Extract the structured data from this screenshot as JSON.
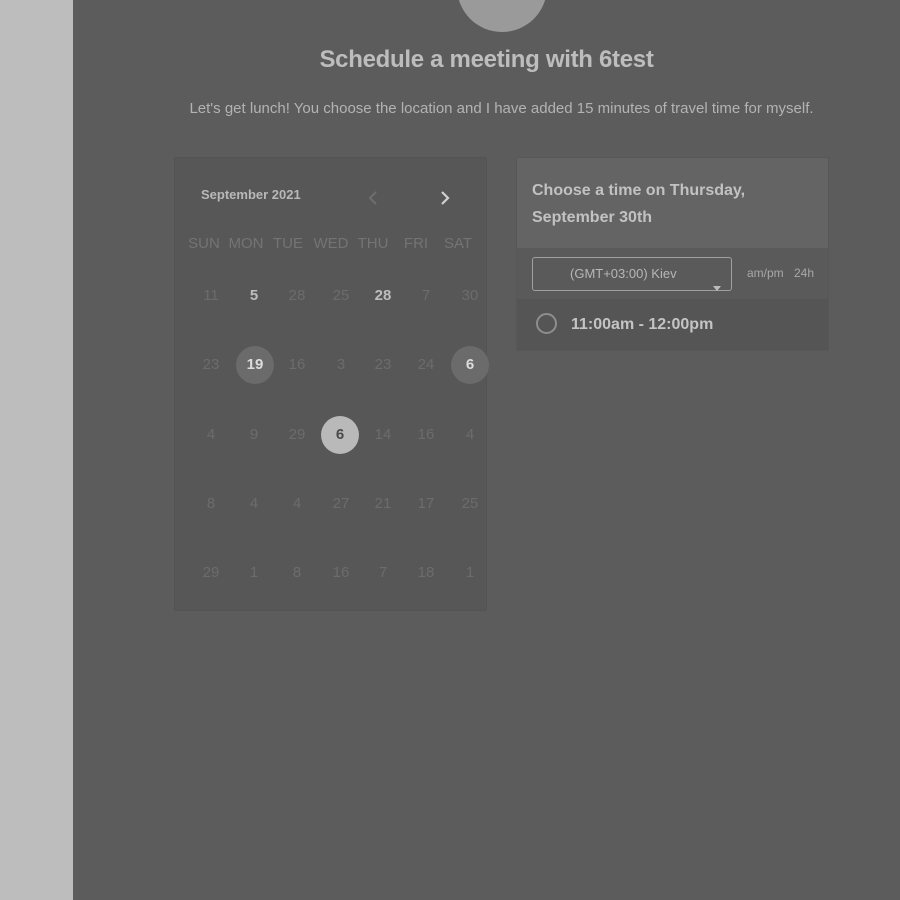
{
  "page": {
    "title": "Schedule a meeting with 6test",
    "subtitle": "Let's get lunch! You choose the location and I have added 15 minutes of travel time for myself."
  },
  "calendar": {
    "month_label": "September 2021",
    "prev_icon": "chevron-left-icon",
    "next_icon": "chevron-right-icon",
    "weekdays": [
      "SUN",
      "MON",
      "TUE",
      "WED",
      "THU",
      "FRI",
      "SAT"
    ],
    "weeks": [
      [
        "11",
        "5",
        "28",
        "25",
        "28",
        "7",
        "30"
      ],
      [
        "23",
        "19",
        "16",
        "3",
        "23",
        "24",
        "6"
      ],
      [
        "4",
        "9",
        "29",
        "6",
        "14",
        "16",
        "4"
      ],
      [
        "8",
        "4",
        "4",
        "27",
        "21",
        "17",
        "25"
      ],
      [
        "29",
        "1",
        "8",
        "16",
        "7",
        "18",
        "1"
      ]
    ]
  },
  "time_panel": {
    "heading": "Choose a time on Thursday, September 30th",
    "timezone": "(GMT+03:00) Kiev",
    "format_ampm": "am/pm",
    "format_24h": "24h",
    "slots": [
      {
        "label": "11:00am - 12:00pm"
      }
    ]
  },
  "colors": {
    "overlay": "#5c5c5c",
    "sidebar": "#bdbdbd",
    "selected_day": "#b9b9b9"
  }
}
